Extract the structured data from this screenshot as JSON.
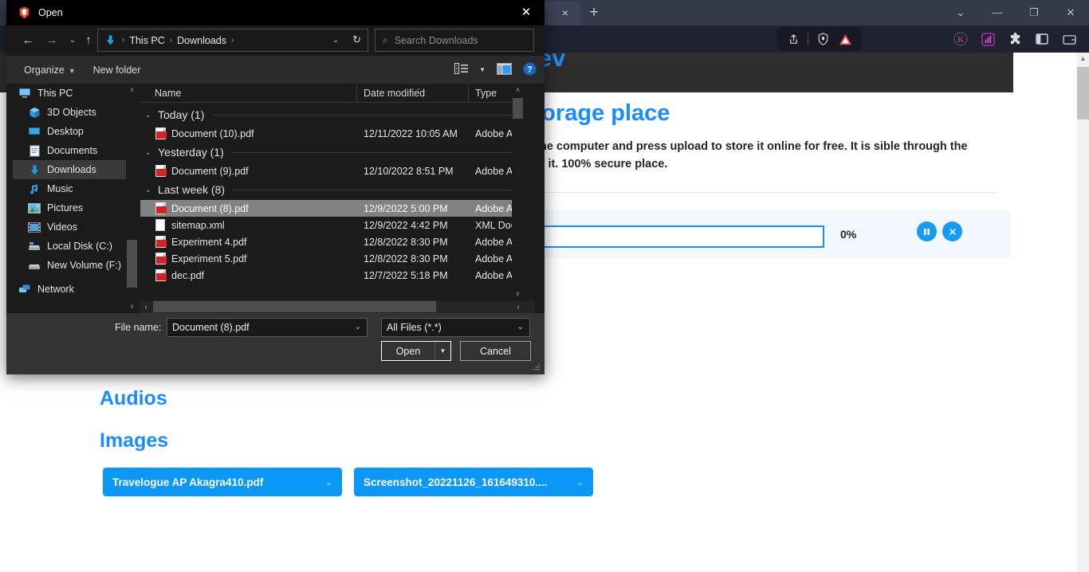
{
  "browser": {
    "tab_close_label": "×",
    "new_tab_label": "+",
    "window_chevron": "⌄",
    "window_minimize": "—",
    "window_maximize": "❐",
    "window_close": "✕",
    "toolbar_icons": [
      {
        "name": "share-icon",
        "glyph": "➦"
      },
      {
        "name": "brave-shields-icon",
        "glyph": "◆"
      },
      {
        "name": "bat-triangle-icon",
        "glyph": "▲"
      },
      {
        "name": "kagi-extension-icon",
        "glyph": "K"
      },
      {
        "name": "chart-extension-icon",
        "glyph": "█"
      },
      {
        "name": "extensions-puzzle-icon",
        "glyph": "❖"
      },
      {
        "name": "sidebar-toggle-icon",
        "glyph": "◫"
      },
      {
        "name": "wallet-icon",
        "glyph": "▢"
      },
      {
        "name": "main-menu-icon",
        "glyph": "☰"
      }
    ],
    "scrollbar_arrow_up": "▲"
  },
  "page": {
    "brand": "I dev",
    "headline": "Cloud Storage place",
    "subtext": "select the file from the computer and press upload to store it online for free. It is sible through the device you uploaded it. 100% secure place.",
    "upload": {
      "input_value": "",
      "percent": "0%",
      "pause_glyph": "❚❚",
      "cancel_glyph": "✕"
    },
    "sections": [
      {
        "title": "Audios"
      },
      {
        "title": "Images"
      }
    ],
    "files": [
      {
        "label": "Travelogue AP Akagra410.pdf",
        "chevron": "⌄"
      },
      {
        "label": "Screenshot_20221126_161649310....",
        "chevron": "⌄"
      }
    ],
    "accent_color": "#1a8cff",
    "chip_color": "#0a97f5"
  },
  "dialog": {
    "title": "Open",
    "close_label": "✕",
    "nav": {
      "back": "←",
      "forward": "→",
      "recent": "⌄",
      "up": "↑"
    },
    "breadcrumb": {
      "items": [
        "This PC",
        "Downloads"
      ],
      "separator": "›",
      "caret": "⌄",
      "refresh": "↻"
    },
    "search": {
      "placeholder": "Search Downloads",
      "icon": "⌕"
    },
    "toolbar": {
      "organize": "Organize",
      "organize_caret": "▼",
      "new_folder": "New folder",
      "view_caret": "▼"
    },
    "nav_pane": {
      "items": [
        {
          "label": "This PC",
          "icon": "monitor-icon",
          "selected": false,
          "root": true
        },
        {
          "label": "3D Objects",
          "icon": "cube-icon",
          "selected": false,
          "root": false
        },
        {
          "label": "Desktop",
          "icon": "desktop-icon",
          "selected": false,
          "root": false
        },
        {
          "label": "Documents",
          "icon": "documents-icon",
          "selected": false,
          "root": false
        },
        {
          "label": "Downloads",
          "icon": "download-icon",
          "selected": true,
          "root": false
        },
        {
          "label": "Music",
          "icon": "music-icon",
          "selected": false,
          "root": false
        },
        {
          "label": "Pictures",
          "icon": "pictures-icon",
          "selected": false,
          "root": false
        },
        {
          "label": "Videos",
          "icon": "videos-icon",
          "selected": false,
          "root": false
        },
        {
          "label": "Local Disk (C:)",
          "icon": "drive-icon",
          "selected": false,
          "root": false
        },
        {
          "label": "New Volume (F:)",
          "icon": "drive-icon",
          "selected": false,
          "root": false
        },
        {
          "label": "Network",
          "icon": "network-icon",
          "selected": false,
          "root": true
        }
      ],
      "scroll_up": "∧",
      "scroll_down": "∨"
    },
    "columns": [
      "Name",
      "Date modified",
      "Type"
    ],
    "sort_caret": "⌄",
    "groups": [
      {
        "label": "Today (1)",
        "chevron": "⌄",
        "rows": [
          {
            "name": "Document (10).pdf",
            "date": "12/11/2022 10:05 AM",
            "type": "Adobe Acrob",
            "icon": "pdf-icon",
            "selected": false
          }
        ]
      },
      {
        "label": "Yesterday (1)",
        "chevron": "⌄",
        "rows": [
          {
            "name": "Document (9).pdf",
            "date": "12/10/2022 8:51 PM",
            "type": "Adobe Acrob",
            "icon": "pdf-icon",
            "selected": false
          }
        ]
      },
      {
        "label": "Last week (8)",
        "chevron": "⌄",
        "rows": [
          {
            "name": "Document (8).pdf",
            "date": "12/9/2022 5:00 PM",
            "type": "Adobe Acrob",
            "icon": "pdf-icon",
            "selected": true
          },
          {
            "name": "sitemap.xml",
            "date": "12/9/2022 4:42 PM",
            "type": "XML Docum",
            "icon": "xml-icon",
            "selected": false
          },
          {
            "name": "Experiment 4.pdf",
            "date": "12/8/2022 8:30 PM",
            "type": "Adobe Acrob",
            "icon": "pdf-icon",
            "selected": false
          },
          {
            "name": "Experiment 5.pdf",
            "date": "12/8/2022 8:30 PM",
            "type": "Adobe Acrob",
            "icon": "pdf-icon",
            "selected": false
          },
          {
            "name": "dec.pdf",
            "date": "12/7/2022 5:18 PM",
            "type": "Adobe Acrob",
            "icon": "pdf-icon",
            "selected": false
          }
        ]
      }
    ],
    "list_scroll": {
      "up": "∧",
      "down": "∨",
      "left": "‹",
      "right": "›"
    },
    "footer": {
      "file_name_label": "File name:",
      "file_name_value": "Document (8).pdf",
      "file_type_value": "All Files (*.*)",
      "caret": "⌄",
      "open_label": "Open",
      "open_split_caret": "▼",
      "cancel_label": "Cancel"
    }
  }
}
